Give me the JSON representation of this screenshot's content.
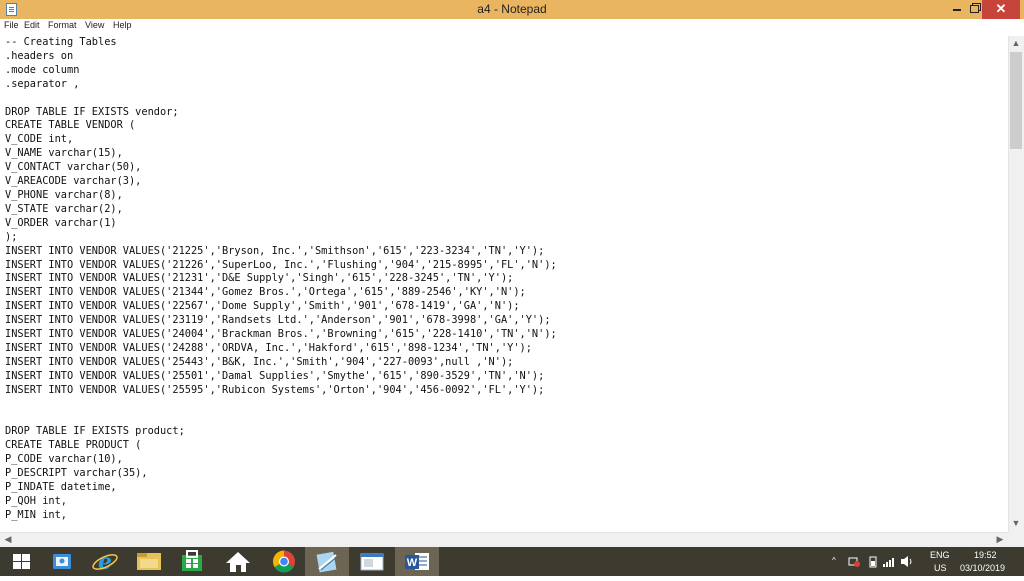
{
  "window": {
    "title": "a4 - Notepad",
    "close_symbol": "✕"
  },
  "menu": [
    "File",
    "Edit",
    "Format",
    "View",
    "Help"
  ],
  "editor_text": "-- Creating Tables\n.headers on\n.mode column\n.separator ,\n\nDROP TABLE IF EXISTS vendor;\nCREATE TABLE VENDOR (\nV_CODE int,\nV_NAME varchar(15),\nV_CONTACT varchar(50),\nV_AREACODE varchar(3),\nV_PHONE varchar(8),\nV_STATE varchar(2),\nV_ORDER varchar(1)\n);\nINSERT INTO VENDOR VALUES('21225','Bryson, Inc.','Smithson','615','223-3234','TN','Y');\nINSERT INTO VENDOR VALUES('21226','SuperLoo, Inc.','Flushing','904','215-8995','FL','N');\nINSERT INTO VENDOR VALUES('21231','D&E Supply','Singh','615','228-3245','TN','Y');\nINSERT INTO VENDOR VALUES('21344','Gomez Bros.','Ortega','615','889-2546','KY','N');\nINSERT INTO VENDOR VALUES('22567','Dome Supply','Smith','901','678-1419','GA','N');\nINSERT INTO VENDOR VALUES('23119','Randsets Ltd.','Anderson','901','678-3998','GA','Y');\nINSERT INTO VENDOR VALUES('24004','Brackman Bros.','Browning','615','228-1410','TN','N');\nINSERT INTO VENDOR VALUES('24288','ORDVA, Inc.','Hakford','615','898-1234','TN','Y');\nINSERT INTO VENDOR VALUES('25443','B&K, Inc.','Smith','904','227-0093',null ,'N');\nINSERT INTO VENDOR VALUES('25501','Damal Supplies','Smythe','615','890-3529','TN','N');\nINSERT INTO VENDOR VALUES('25595','Rubicon Systems','Orton','904','456-0092','FL','Y');\n\n\nDROP TABLE IF EXISTS product;\nCREATE TABLE PRODUCT (\nP_CODE varchar(10),\nP_DESCRIPT varchar(35),\nP_INDATE datetime,\nP_QOH int,\nP_MIN int,",
  "scrollbar": {
    "up": "▲",
    "down": "▼",
    "left": "◀",
    "right": "▶"
  },
  "taskbar": {
    "apps": [
      {
        "name": "start",
        "icon": "windows-logo-icon"
      },
      {
        "name": "store",
        "icon": "store-bag-icon"
      },
      {
        "name": "internet-explorer",
        "icon": "ie-icon",
        "glyph": "e"
      },
      {
        "name": "file-explorer",
        "icon": "folder-icon"
      },
      {
        "name": "store-app",
        "icon": "shopping-bag-icon"
      },
      {
        "name": "home",
        "icon": "home-icon"
      },
      {
        "name": "chrome",
        "icon": "chrome-icon"
      },
      {
        "name": "notepad",
        "icon": "notepad-icon",
        "active": true
      },
      {
        "name": "window-app",
        "icon": "window-icon"
      },
      {
        "name": "word",
        "icon": "word-icon",
        "glyph": "W"
      }
    ],
    "tray": {
      "language": "ENG",
      "region": "US",
      "time": "19:52",
      "date": "03/10/2019",
      "chevron": "^"
    }
  },
  "colors": {
    "titlebar": "#e9b561",
    "close": "#c7443a",
    "taskbar": "#3d3a2f",
    "taskbar_active": "#6c6553"
  }
}
